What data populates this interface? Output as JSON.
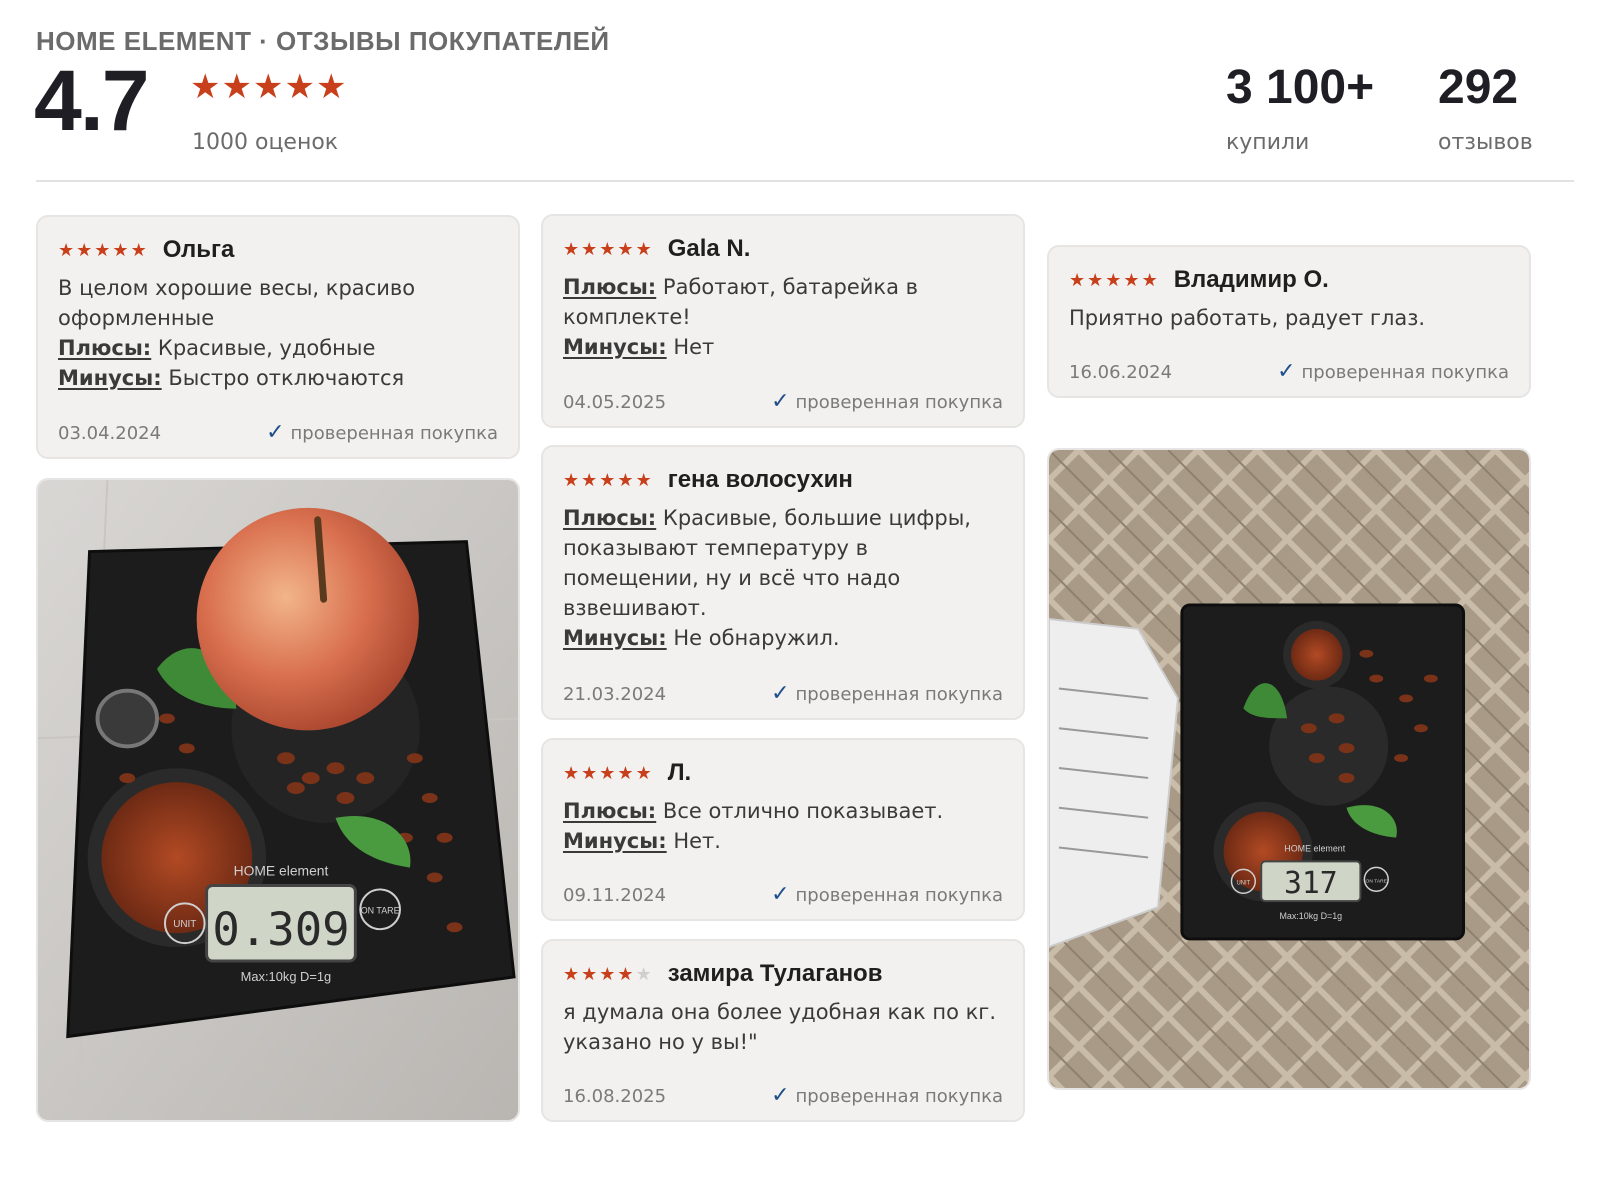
{
  "header": {
    "brand_line": "HOME ELEMENT · ОТЗЫВЫ ПОКУПАТЕЛЕЙ",
    "rating": "4.7",
    "stars": 5,
    "ratings_count": "1000 оценок",
    "bought_value": "3 100+",
    "bought_label": "купили",
    "reviews_value": "292",
    "reviews_label": "отзывов"
  },
  "labels": {
    "pros": "Плюсы:",
    "cons": "Минусы:",
    "verified": "проверенная покупка"
  },
  "reviews": [
    {
      "author": "Ольга",
      "rating": 5,
      "text": "В целом хорошие весы, красиво оформленные",
      "pros": "Красивые, удобные",
      "cons": "Быстро отключаются",
      "date": "03.04.2024"
    },
    {
      "author": "Gala N.",
      "rating": 5,
      "pros": "Работают, батарейка в комплекте!",
      "cons": "Нет",
      "date": "04.05.2025"
    },
    {
      "author": "гена волосухин",
      "rating": 5,
      "pros": "Красивые, большие цифры, показывают температуру в помещении, ну и всё что надо взвешивают.",
      "cons": "Не обнаружил.",
      "date": "21.03.2024"
    },
    {
      "author": "Л.",
      "rating": 5,
      "pros": "Все отлично показывает.",
      "cons": "Нет.",
      "date": "09.11.2024"
    },
    {
      "author": "замира Тулаганов",
      "rating": 4,
      "text": "я думала она более удобная как по кг. указано но у вы!\"",
      "date": "16.08.2025"
    },
    {
      "author": "Владимир О.",
      "rating": 5,
      "text": "Приятно работать, радует глаз.",
      "date": "16.06.2024"
    }
  ],
  "photos": {
    "left": {
      "display": "0.309",
      "scale_brand": "HOME element",
      "unit_label": "UNIT",
      "tare_label": "ON TARE",
      "spec": "Max:10kg  D=1g"
    },
    "right": {
      "display": "317",
      "scale_brand": "HOME element",
      "unit_label": "UNIT",
      "tare_label": "ON TARE",
      "spec": "Max:10kg  D=1g"
    }
  },
  "colors": {
    "star": "#c8401b",
    "star_off": "#cfcfcf",
    "check": "#1f4f8b",
    "card_bg": "#f2f1ef"
  }
}
